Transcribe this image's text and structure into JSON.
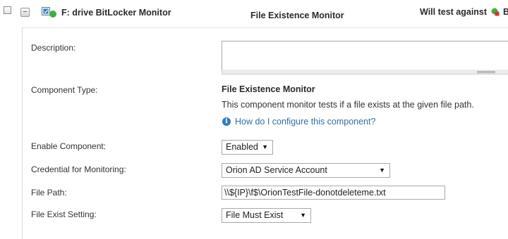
{
  "header": {
    "component_title": "F: drive BitLocker Monitor",
    "component_type": "File Existence Monitor",
    "will_test_label": "Will test against",
    "node_truncated": "B"
  },
  "form": {
    "description": {
      "label": "Description:",
      "value": ""
    },
    "component_type": {
      "label": "Component Type:",
      "name": "File Existence Monitor",
      "description": "This component monitor tests if a file exists at the given file path.",
      "help_link": "How do I configure this component?"
    },
    "enable_component": {
      "label": "Enable Component:",
      "value": "Enabled"
    },
    "credential": {
      "label": "Credential for Monitoring:",
      "value": "Orion AD Service Account"
    },
    "file_path": {
      "label": "File Path:",
      "value": "\\\\${IP}\\f$\\OrionTestFile-donotdeleteme.txt"
    },
    "file_exist_setting": {
      "label": "File Exist Setting:",
      "value": "File Must Exist"
    }
  },
  "icons": {
    "collapse": "minus-icon",
    "monitor": "component-monitor-icon",
    "status": "status-up-green",
    "node": "node-status-icon",
    "help": "info-icon",
    "dropdown": "dropdown-arrow-icon"
  },
  "colors": {
    "status_green": "#3cb043",
    "node_red": "#d9342b",
    "link_blue": "#2f6fa6",
    "help_icon_blue": "#2f7fc1"
  }
}
